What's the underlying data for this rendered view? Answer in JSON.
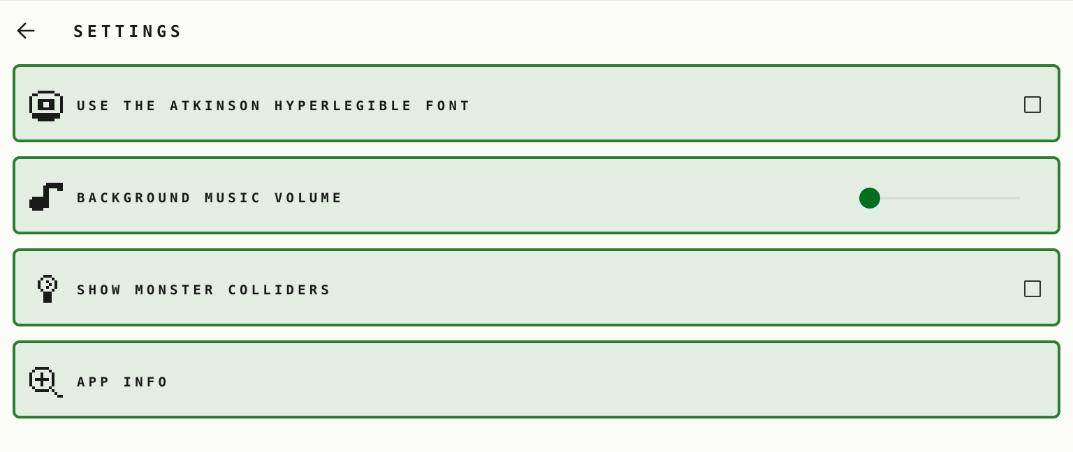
{
  "header": {
    "title": "SETTINGS",
    "back_icon": "arrow-left-icon"
  },
  "settings": [
    {
      "label": "USE THE ATKINSON HYPERLEGIBLE FONT",
      "icon": "eye-icon",
      "control": "checkbox",
      "checked": false
    },
    {
      "label": "BACKGROUND MUSIC VOLUME",
      "icon": "music-note-icon",
      "control": "slider",
      "value": 0
    },
    {
      "label": "SHOW MONSTER COLLIDERS",
      "icon": "lightbulb-icon",
      "control": "checkbox",
      "checked": false
    },
    {
      "label": "APP INFO",
      "icon": "zoom-in-icon",
      "control": "none"
    }
  ],
  "colors": {
    "background": "#fbfcf7",
    "card_fill": "#e3ede1",
    "card_border": "#2e7d32",
    "accent": "#006e1e",
    "text": "#1a1a1a"
  }
}
